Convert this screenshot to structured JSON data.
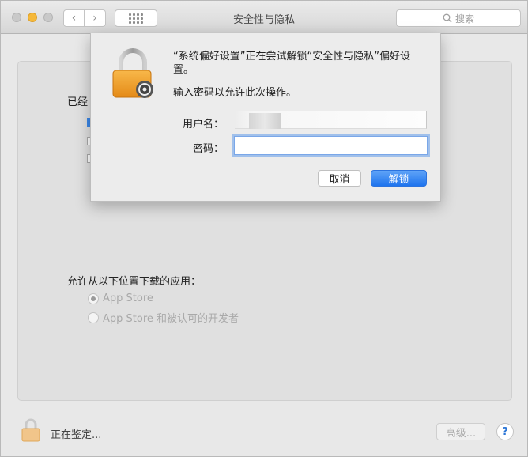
{
  "window": {
    "title": "安全性与隐私",
    "search_placeholder": "搜索",
    "colors": {
      "minimize": "#f5b83a",
      "accent": "#1e74ee"
    }
  },
  "toolbar": {
    "back_icon": "chevron-left-icon",
    "forward_icon": "chevron-right-icon",
    "grid_icon": "grid-icon"
  },
  "dialog": {
    "message": "“系统偏好设置”正在尝试解锁“安全性与隐私”偏好设置。",
    "submessage": "输入密码以允许此次操作。",
    "username_label": "用户名：",
    "username_value": "",
    "password_label": "密码：",
    "password_value": "",
    "cancel_label": "取消",
    "unlock_label": "解锁"
  },
  "background": {
    "partial_label": "已经",
    "allow_label": "允许从以下位置下载的应用：",
    "options": [
      {
        "label": "App Store",
        "selected": true
      },
      {
        "label": "App Store 和被认可的开发者",
        "selected": false
      }
    ]
  },
  "footer": {
    "status_text": "正在鉴定...",
    "advanced_label": "高级...",
    "help_label": "?"
  }
}
